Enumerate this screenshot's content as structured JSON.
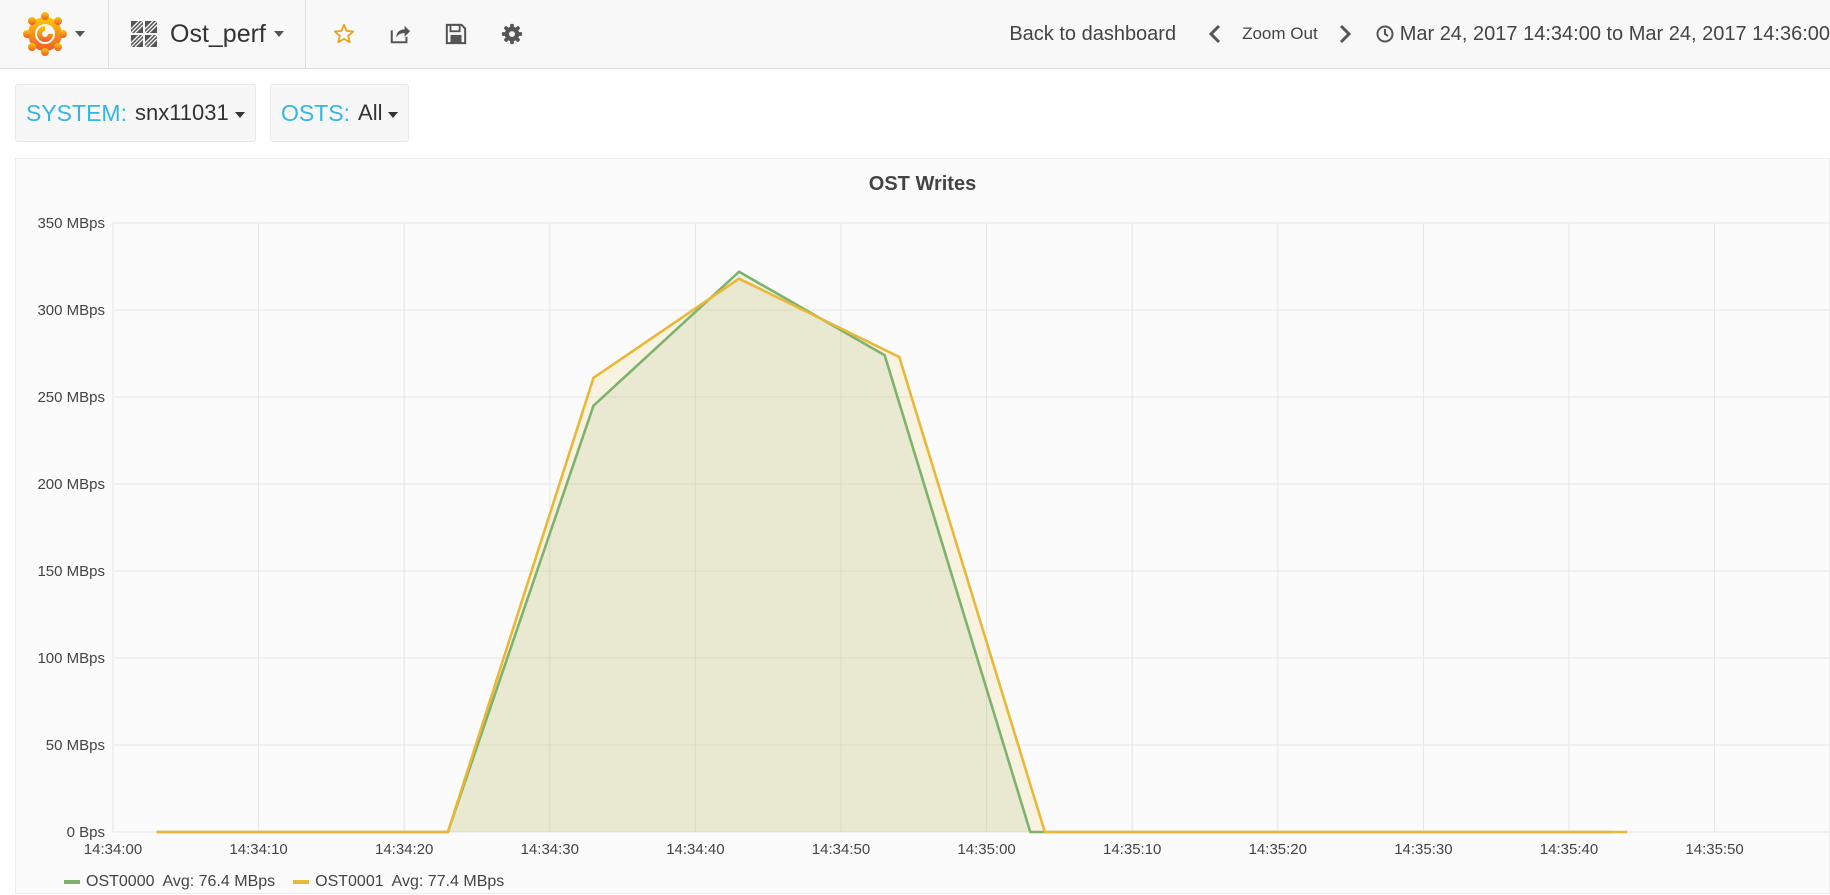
{
  "navbar": {
    "dashboard_title": "Ost_perf",
    "back_to_dashboard": "Back to dashboard",
    "zoom_out": "Zoom Out",
    "time_range": "Mar 24, 2017 14:34:00 to Mar 24, 2017 14:36:00",
    "icons": [
      "grafana-logo-icon",
      "star-icon",
      "share-icon",
      "save-icon",
      "gear-icon",
      "chevron-left-icon",
      "chevron-right-icon",
      "clock-icon"
    ],
    "star_color": "#e8a21c"
  },
  "variables": [
    {
      "label": "SYSTEM:",
      "value": "snx11031"
    },
    {
      "label": "OSTS:",
      "value": "All"
    }
  ],
  "panel": {
    "title": "OST Writes"
  },
  "chart_data": {
    "type": "area",
    "title": "OST Writes",
    "y_unit": "MBps",
    "y_ticks": [
      "350 MBps",
      "300 MBps",
      "250 MBps",
      "200 MBps",
      "150 MBps",
      "100 MBps",
      "50 MBps",
      "0 Bps"
    ],
    "y_tick_values": [
      350,
      300,
      250,
      200,
      150,
      100,
      50,
      0
    ],
    "ylim": [
      0,
      350
    ],
    "x_ticks": [
      "14:34:00",
      "14:34:10",
      "14:34:20",
      "14:34:30",
      "14:34:40",
      "14:34:50",
      "14:35:00",
      "14:35:10",
      "14:35:20",
      "14:35:30",
      "14:35:40",
      "14:35:50"
    ],
    "grid": true,
    "legend_position": "bottom-left",
    "series": [
      {
        "name": "OST0000",
        "color": "#7eb26d",
        "avg_label": "Avg: 76.4 MBps",
        "x": [
          "14:34:03",
          "14:34:23",
          "14:34:33",
          "14:34:43",
          "14:34:53",
          "14:35:03",
          "14:35:43"
        ],
        "values": [
          0,
          0,
          245,
          322,
          274,
          0,
          0
        ]
      },
      {
        "name": "OST0001",
        "color": "#eab839",
        "avg_label": "Avg: 77.4 MBps",
        "x": [
          "14:34:03",
          "14:34:23",
          "14:34:33",
          "14:34:43",
          "14:34:54",
          "14:35:04",
          "14:35:44"
        ],
        "values": [
          0,
          0,
          261,
          318,
          273,
          0,
          0
        ]
      }
    ]
  }
}
